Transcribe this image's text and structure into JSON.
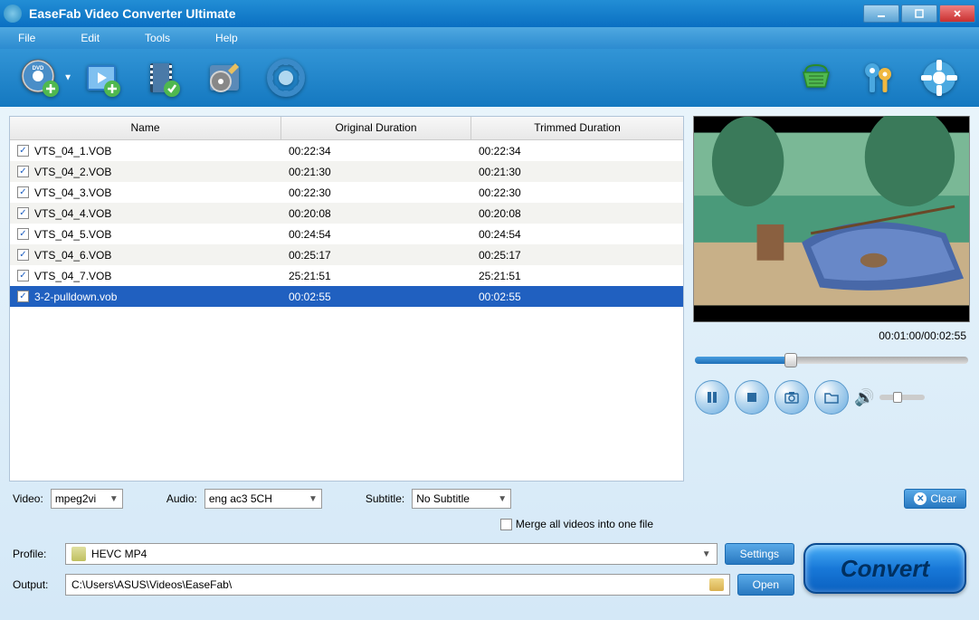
{
  "window": {
    "title": "EaseFab Video Converter Ultimate"
  },
  "menu": {
    "file": "File",
    "edit": "Edit",
    "tools": "Tools",
    "help": "Help"
  },
  "table": {
    "headers": {
      "name": "Name",
      "orig": "Original Duration",
      "trim": "Trimmed Duration"
    },
    "rows": [
      {
        "name": "VTS_04_1.VOB",
        "orig": "00:22:34",
        "trim": "00:22:34",
        "checked": true,
        "selected": false
      },
      {
        "name": "VTS_04_2.VOB",
        "orig": "00:21:30",
        "trim": "00:21:30",
        "checked": true,
        "selected": false
      },
      {
        "name": "VTS_04_3.VOB",
        "orig": "00:22:30",
        "trim": "00:22:30",
        "checked": true,
        "selected": false
      },
      {
        "name": "VTS_04_4.VOB",
        "orig": "00:20:08",
        "trim": "00:20:08",
        "checked": true,
        "selected": false
      },
      {
        "name": "VTS_04_5.VOB",
        "orig": "00:24:54",
        "trim": "00:24:54",
        "checked": true,
        "selected": false
      },
      {
        "name": "VTS_04_6.VOB",
        "orig": "00:25:17",
        "trim": "00:25:17",
        "checked": true,
        "selected": false
      },
      {
        "name": "VTS_04_7.VOB",
        "orig": "25:21:51",
        "trim": "25:21:51",
        "checked": true,
        "selected": false
      },
      {
        "name": "3-2-pulldown.vob",
        "orig": "00:02:55",
        "trim": "00:02:55",
        "checked": true,
        "selected": true
      }
    ]
  },
  "preview": {
    "time": "00:01:00/00:02:55"
  },
  "tracks": {
    "video_label": "Video:",
    "video_value": "mpeg2vi",
    "audio_label": "Audio:",
    "audio_value": "eng ac3 5CH",
    "subtitle_label": "Subtitle:",
    "subtitle_value": "No Subtitle",
    "clear": "Clear"
  },
  "merge": {
    "label": "Merge all videos into one file"
  },
  "output": {
    "profile_label": "Profile:",
    "profile_value": "HEVC MP4",
    "settings": "Settings",
    "output_label": "Output:",
    "output_path": "C:\\Users\\ASUS\\Videos\\EaseFab\\",
    "open": "Open"
  },
  "convert": "Convert"
}
